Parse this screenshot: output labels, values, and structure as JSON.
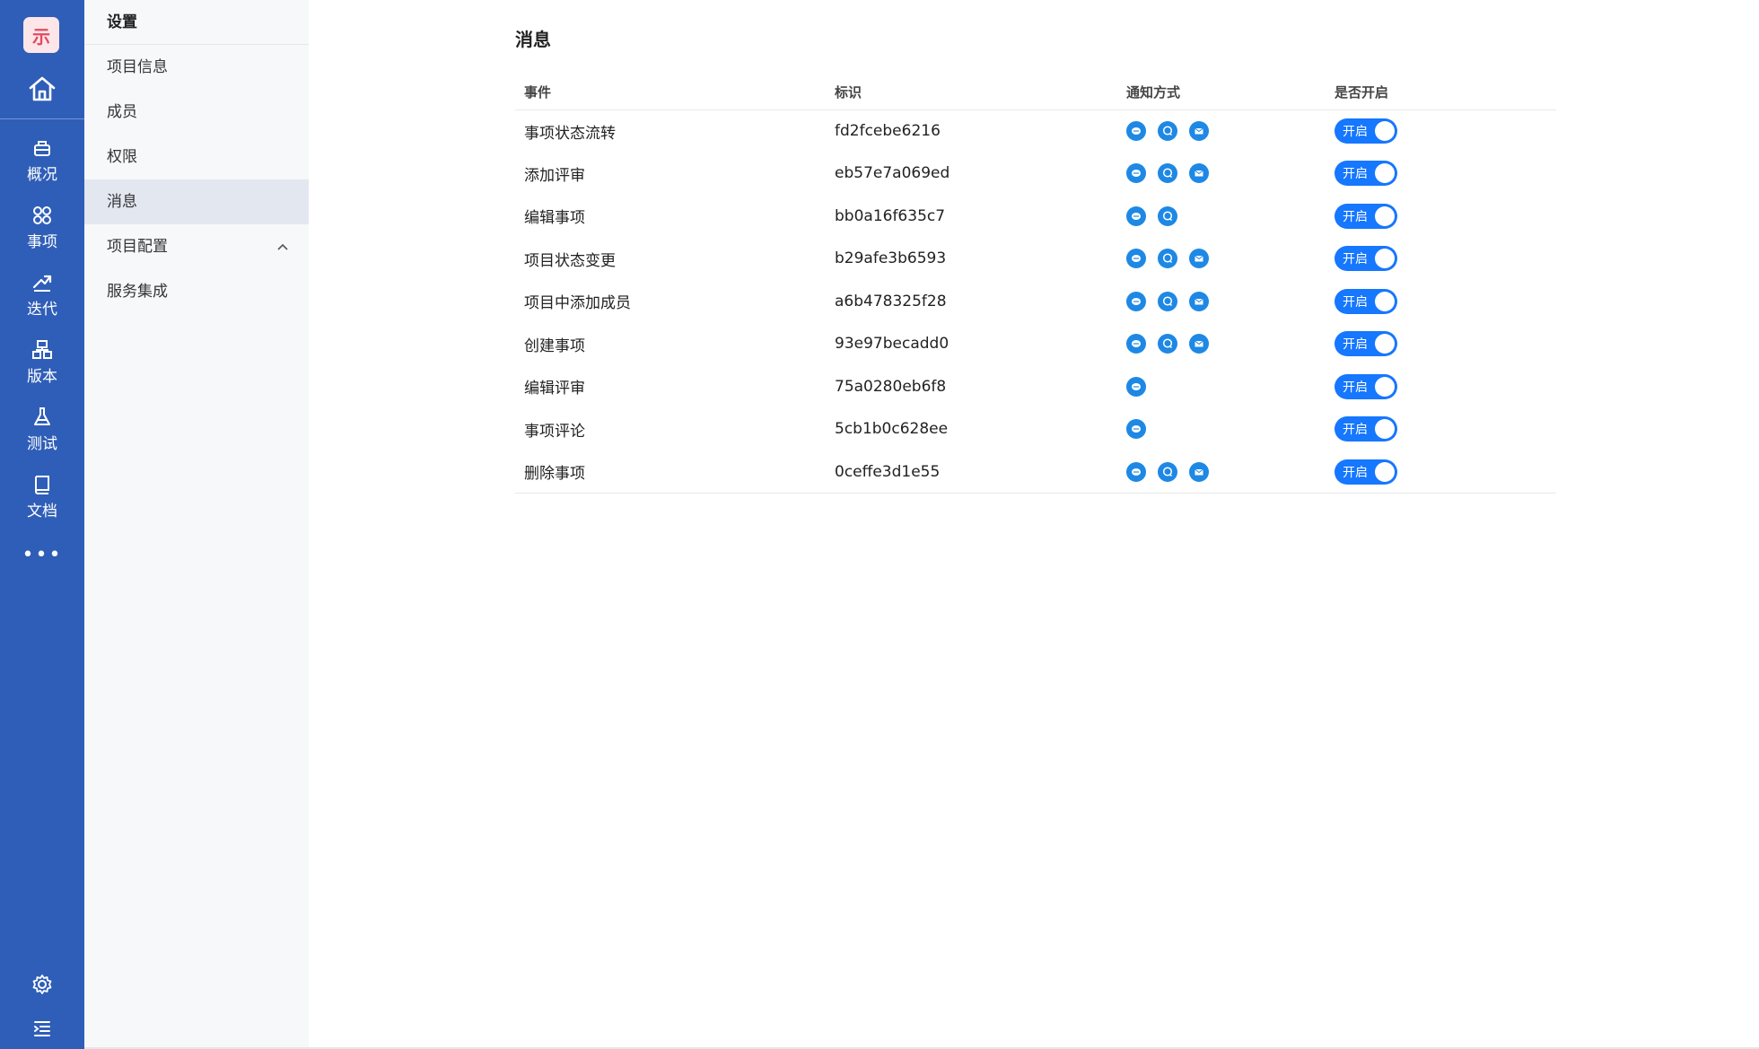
{
  "rail": {
    "logo_text": "示",
    "nav": [
      {
        "label": "概况",
        "icon": "overview-icon"
      },
      {
        "label": "事项",
        "icon": "workitem-icon"
      },
      {
        "label": "迭代",
        "icon": "sprint-icon"
      },
      {
        "label": "版本",
        "icon": "version-icon"
      },
      {
        "label": "测试",
        "icon": "test-icon"
      },
      {
        "label": "文档",
        "icon": "document-icon"
      }
    ],
    "more_text": "•••",
    "color": "#2f5eb8"
  },
  "sidebar": {
    "title": "设置",
    "items": [
      {
        "label": "项目信息"
      },
      {
        "label": "成员"
      },
      {
        "label": "权限"
      },
      {
        "label": "消息",
        "active": true
      },
      {
        "label": "项目配置",
        "expandable": true
      },
      {
        "label": "服务集成"
      }
    ]
  },
  "main": {
    "title": "消息",
    "columns": [
      "事件",
      "标识",
      "通知方式",
      "是否开启"
    ],
    "toggle_label": "开启",
    "rows": [
      {
        "event": "事项状态流转",
        "id": "fd2fcebe6216",
        "channels": [
          "message",
          "chat",
          "email"
        ],
        "enabled": true
      },
      {
        "event": "添加评审",
        "id": "eb57e7a069ed",
        "channels": [
          "message",
          "chat",
          "email"
        ],
        "enabled": true
      },
      {
        "event": "编辑事项",
        "id": "bb0a16f635c7",
        "channels": [
          "message",
          "chat"
        ],
        "enabled": true
      },
      {
        "event": "项目状态变更",
        "id": "b29afe3b6593",
        "channels": [
          "message",
          "chat",
          "email"
        ],
        "enabled": true
      },
      {
        "event": "项目中添加成员",
        "id": "a6b478325f28",
        "channels": [
          "message",
          "chat",
          "email"
        ],
        "enabled": true
      },
      {
        "event": "创建事项",
        "id": "93e97becadd0",
        "channels": [
          "message",
          "chat",
          "email"
        ],
        "enabled": true
      },
      {
        "event": "编辑评审",
        "id": "75a0280eb6f8",
        "channels": [
          "message"
        ],
        "enabled": true
      },
      {
        "event": "事项评论",
        "id": "5cb1b0c628ee",
        "channels": [
          "message"
        ],
        "enabled": true
      },
      {
        "event": "删除事项",
        "id": "0ceffe3d1e55",
        "channels": [
          "message",
          "chat",
          "email"
        ],
        "enabled": true
      }
    ],
    "accent": "#1677ff",
    "channel_color": "#1e88e5"
  }
}
